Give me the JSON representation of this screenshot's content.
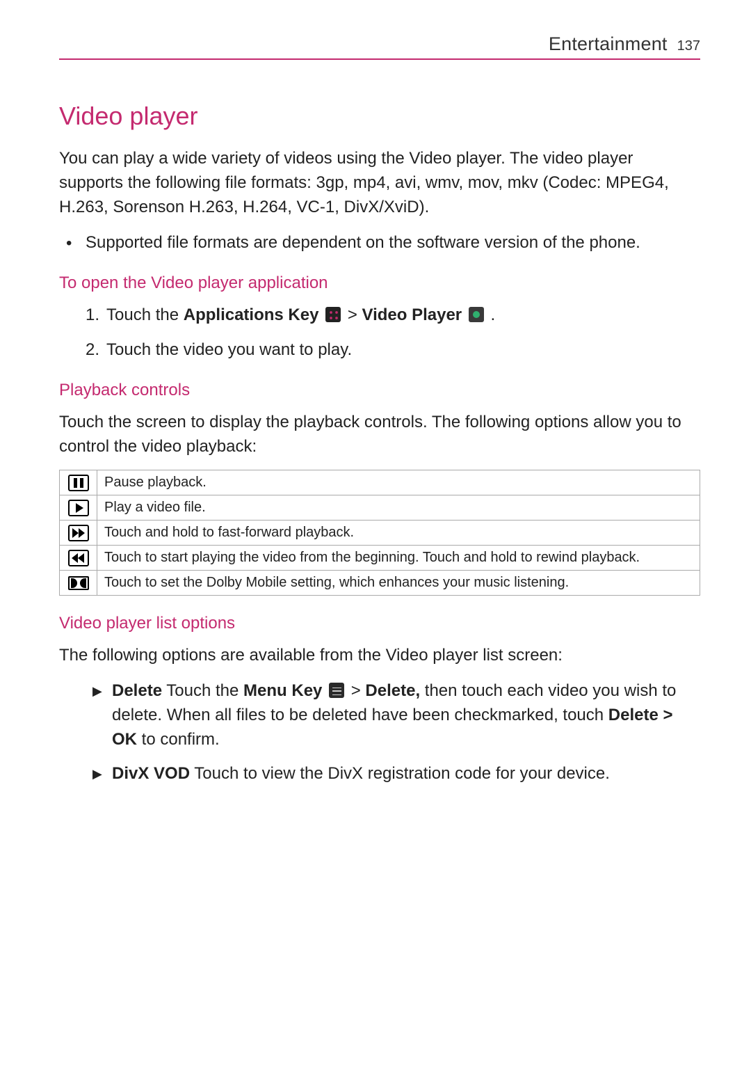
{
  "header": {
    "section": "Entertainment",
    "page": "137"
  },
  "title": "Video player",
  "intro": "You can play a wide variety of videos using the Video player. The video player supports the following file formats: 3gp, mp4, avi, wmv, mov, mkv (Codec: MPEG4, H.263, Sorenson H.263, H.264, VC-1, DivX/XviD).",
  "bullet1": "Supported file formats are dependent on the software version of the phone.",
  "subhead1": "To open the Video player application",
  "step1_prefix": "Touch the ",
  "step1_key": "Applications Key",
  "step1_mid": " > ",
  "step1_vp": "Video Player",
  "step1_end": " .",
  "step2": "Touch the video you want to play.",
  "subhead2": "Playback controls",
  "playback_intro": "Touch the screen to display the playback controls. The following options allow you to control the video playback:",
  "controls": {
    "pause": "Pause playback.",
    "play": "Play a video file.",
    "ff": "Touch and hold to fast-forward playback.",
    "rw": "Touch to start playing the video from the beginning. Touch and hold to rewind playback.",
    "dolby": "Touch to set the Dolby Mobile setting, which enhances your music listening."
  },
  "subhead3": "Video player list options",
  "list_intro": "The following options are available from the Video player list screen:",
  "opt1": {
    "label": "Delete",
    "t1": "  Touch the ",
    "menu": "Menu Key",
    "t2": "  > ",
    "del": "Delete,",
    "t3": " then touch each video you wish to delete. When all files to be deleted have been checkmarked, touch ",
    "confirm": "Delete > OK",
    "t4": " to confirm."
  },
  "opt2": {
    "label": "DivX VOD",
    "text": " Touch to view the DivX registration code for your device."
  }
}
